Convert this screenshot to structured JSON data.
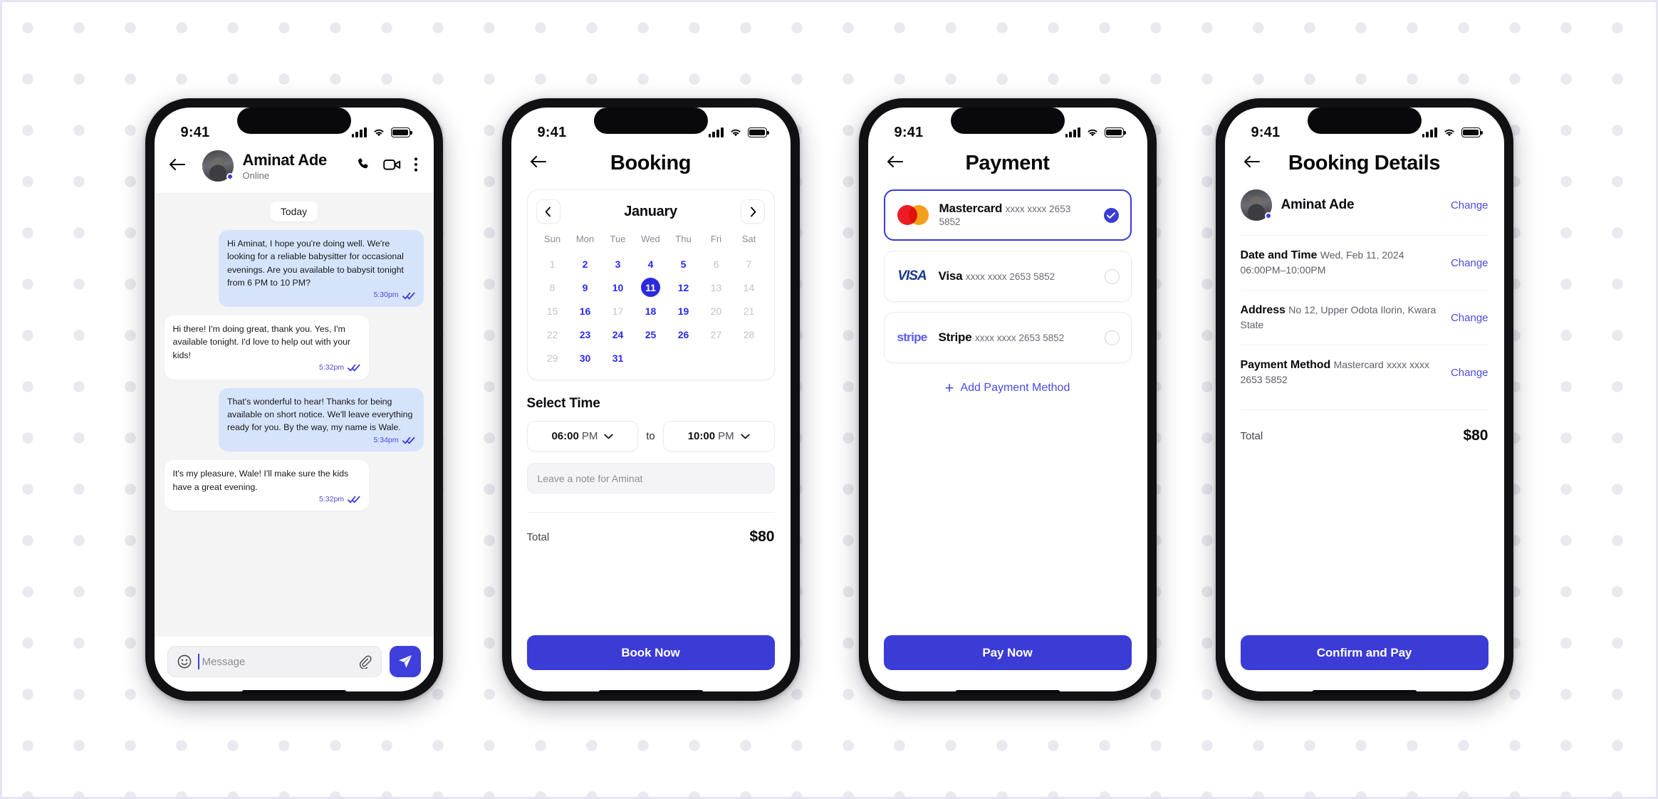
{
  "status_bar": {
    "time": "9:41"
  },
  "chat": {
    "contact_name": "Aminat Ade",
    "contact_status": "Online",
    "day_label": "Today",
    "messages": [
      {
        "side": "out",
        "text": "Hi Aminat, I hope you're doing well. We're looking for a reliable babysitter for occasional evenings. Are you available to babysit tonight from 6 PM to 10 PM?",
        "time": "5:30pm"
      },
      {
        "side": "in",
        "text": "Hi there! I'm doing great, thank you. Yes, I'm available tonight. I'd love to help out with your kids!",
        "time": "5:32pm"
      },
      {
        "side": "out",
        "text": "That's wonderful to hear! Thanks for being available on short notice. We'll leave everything ready for you. By the way, my name is Wale.",
        "time": "5:34pm"
      },
      {
        "side": "in",
        "text": "It's my pleasure, Wale! I'll make sure the kids have a great evening.",
        "time": "5:32pm"
      }
    ],
    "composer": {
      "placeholder": "Message",
      "value": ""
    }
  },
  "booking": {
    "title": "Booking",
    "calendar": {
      "month": "January",
      "weekdays": [
        "Sun",
        "Mon",
        "Tue",
        "Wed",
        "Thu",
        "Fri",
        "Sat"
      ],
      "weeks": [
        [
          {
            "d": "1",
            "s": "off"
          },
          {
            "d": "2",
            "s": "on"
          },
          {
            "d": "3",
            "s": "on"
          },
          {
            "d": "4",
            "s": "on"
          },
          {
            "d": "5",
            "s": "on"
          },
          {
            "d": "6",
            "s": "off"
          },
          {
            "d": "7",
            "s": "off"
          }
        ],
        [
          {
            "d": "8",
            "s": "off"
          },
          {
            "d": "9",
            "s": "on"
          },
          {
            "d": "10",
            "s": "on"
          },
          {
            "d": "11",
            "s": "sel"
          },
          {
            "d": "12",
            "s": "on"
          },
          {
            "d": "13",
            "s": "off"
          },
          {
            "d": "14",
            "s": "off"
          }
        ],
        [
          {
            "d": "15",
            "s": "off"
          },
          {
            "d": "16",
            "s": "on"
          },
          {
            "d": "17",
            "s": "off"
          },
          {
            "d": "18",
            "s": "on"
          },
          {
            "d": "19",
            "s": "on"
          },
          {
            "d": "20",
            "s": "off"
          },
          {
            "d": "21",
            "s": "off"
          }
        ],
        [
          {
            "d": "22",
            "s": "off"
          },
          {
            "d": "23",
            "s": "on"
          },
          {
            "d": "24",
            "s": "on"
          },
          {
            "d": "25",
            "s": "on"
          },
          {
            "d": "26",
            "s": "on"
          },
          {
            "d": "27",
            "s": "off"
          },
          {
            "d": "28",
            "s": "off"
          }
        ],
        [
          {
            "d": "29",
            "s": "off"
          },
          {
            "d": "30",
            "s": "on"
          },
          {
            "d": "31",
            "s": "on"
          },
          {
            "d": "",
            "s": "blank"
          },
          {
            "d": "",
            "s": "blank"
          },
          {
            "d": "",
            "s": "blank"
          },
          {
            "d": "",
            "s": "blank"
          }
        ]
      ]
    },
    "select_time_label": "Select Time",
    "start_time": {
      "hour": "06:00",
      "period": "PM"
    },
    "to_label": "to",
    "end_time": {
      "hour": "10:00",
      "period": "PM"
    },
    "note_placeholder": "Leave a note for Aminat",
    "total_label": "Total",
    "total_value": "$80",
    "cta": "Book Now"
  },
  "payment": {
    "title": "Payment",
    "methods": [
      {
        "brand": "mastercard",
        "name": "Mastercard",
        "number": "xxxx xxxx 2653 5852",
        "selected": true
      },
      {
        "brand": "visa",
        "name": "Visa",
        "number": "xxxx xxxx 2653 5852",
        "selected": false
      },
      {
        "brand": "stripe",
        "name": "Stripe",
        "number": "xxxx xxxx 2653 5852",
        "selected": false
      }
    ],
    "brand_text": {
      "visa": "VISA",
      "stripe": "stripe"
    },
    "add_method_label": "Add Payment Method",
    "cta": "Pay Now"
  },
  "details": {
    "title": "Booking Details",
    "person_name": "Aminat Ade",
    "change_label": "Change",
    "sections": [
      {
        "heading": "Date and Time",
        "line1": "Wed, Feb 11, 2024",
        "line2": "06:00PM–10:00PM",
        "change": "Change"
      },
      {
        "heading": "Address",
        "line1": "No 12, Upper Odota Ilorin, Kwara",
        "line2": "State",
        "change": "Change"
      },
      {
        "heading": "Payment Method",
        "line1": "Mastercard",
        "line2": "xxxx xxxx 2653 5852",
        "change": "Change"
      }
    ],
    "total_label": "Total",
    "total_value": "$80",
    "cta": "Confirm and Pay"
  },
  "colors": {
    "accent": "#3b3bd6",
    "blue_text": "#2a2af0",
    "bubble_out": "#d6e4fb",
    "chat_bg": "#f4f4f5"
  }
}
